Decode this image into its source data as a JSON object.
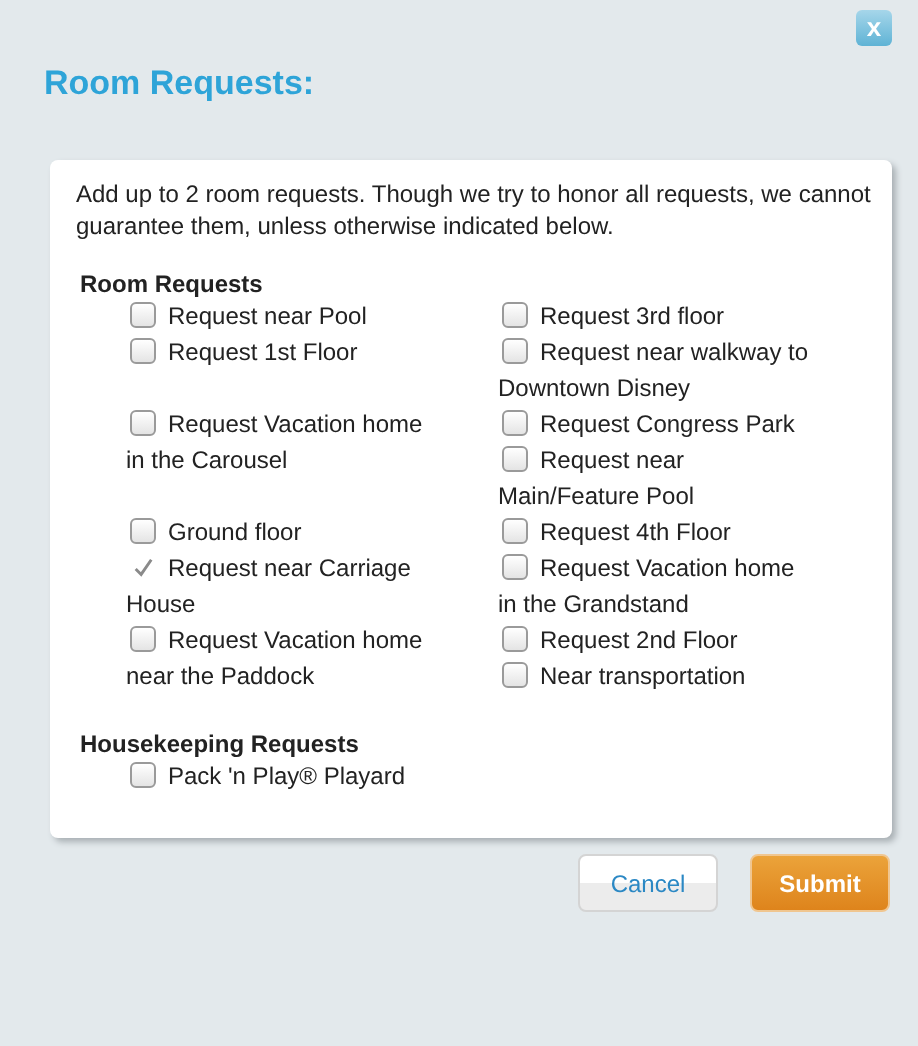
{
  "dialog": {
    "title": "Room Requests:",
    "close_label": "x"
  },
  "intro": "Add up to 2 room requests. Though we try to honor all requests, we cannot guarantee them, unless otherwise indicated below.",
  "sections": [
    {
      "heading": "Room Requests",
      "rows": [
        {
          "left": [
            {
              "label": "Request near Pool",
              "checked": false
            }
          ],
          "right": [
            {
              "label": "Request 3rd floor",
              "checked": false
            }
          ]
        },
        {
          "left": [
            {
              "label": "Request 1st Floor",
              "checked": false
            }
          ],
          "right": [
            {
              "label": "Request near walkway to Downtown Disney",
              "checked": false
            }
          ]
        },
        {
          "left": [
            {
              "label": "Request Vacation home in the Carousel",
              "checked": false
            }
          ],
          "right": [
            {
              "label": "Request Congress Park",
              "checked": false
            },
            {
              "label": "Request near Main/Feature Pool",
              "checked": false
            }
          ]
        },
        {
          "left": [
            {
              "label": "Ground floor",
              "checked": false
            }
          ],
          "right": [
            {
              "label": "Request 4th Floor",
              "checked": false
            }
          ]
        },
        {
          "left": [
            {
              "label": "Request near Carriage House",
              "checked": true
            }
          ],
          "right": [
            {
              "label": "Request Vacation home in the Grandstand",
              "checked": false
            }
          ]
        },
        {
          "left": [
            {
              "label": "Request Vacation home near the Paddock",
              "checked": false
            }
          ],
          "right": [
            {
              "label": "Request 2nd Floor",
              "checked": false
            },
            {
              "label": "Near transportation",
              "checked": false
            }
          ]
        }
      ]
    },
    {
      "heading": "Housekeeping Requests",
      "rows": [
        {
          "left": [
            {
              "label": "Pack 'n Play® Playard",
              "checked": false
            }
          ],
          "right": []
        }
      ]
    }
  ],
  "buttons": [
    {
      "label": "Cancel",
      "kind": "secondary"
    },
    {
      "label": "Submit",
      "kind": "primary"
    }
  ]
}
